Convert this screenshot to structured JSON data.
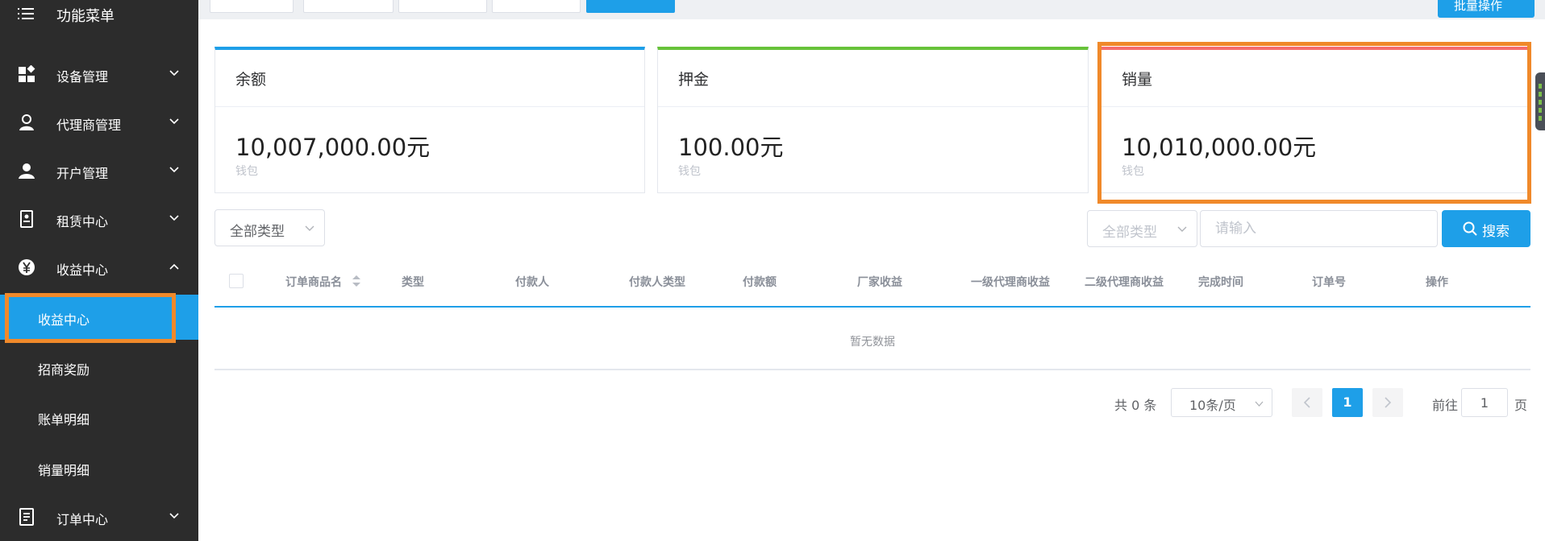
{
  "sidebar": {
    "menu_title": "功能菜单",
    "items": [
      {
        "label": "设备管理"
      },
      {
        "label": "代理商管理"
      },
      {
        "label": "开户管理"
      },
      {
        "label": "租赁中心"
      },
      {
        "label": "收益中心"
      }
    ],
    "sub_items": [
      {
        "label": "收益中心"
      },
      {
        "label": "招商奖励"
      },
      {
        "label": "账单明细"
      },
      {
        "label": "销量明细"
      }
    ],
    "bottom_item": {
      "label": "订单中心"
    }
  },
  "topbar": {
    "batch_button": "批量操作"
  },
  "cards": [
    {
      "title": "余额",
      "value": "10,007,000.00元",
      "sub": "钱包",
      "accent": "#1e9fe8"
    },
    {
      "title": "押金",
      "value": "100.00元",
      "sub": "钱包",
      "accent": "#67c23a"
    },
    {
      "title": "销量",
      "value": "10,010,000.00元",
      "sub": "钱包",
      "accent": "#f56c6c"
    }
  ],
  "filters": {
    "type_select": "全部类型",
    "type_select_right": "全部类型",
    "search_placeholder": "请输入",
    "search_button": "搜索"
  },
  "table": {
    "columns": [
      "订单商品名",
      "类型",
      "付款人",
      "付款人类型",
      "付款额",
      "厂家收益",
      "一级代理商收益",
      "二级代理商收益",
      "完成时间",
      "订单号",
      "操作"
    ],
    "empty_text": "暂无数据"
  },
  "pagination": {
    "total": "共 0 条",
    "page_size": "10条/页",
    "current_page": "1",
    "goto_label": "前往",
    "goto_value": "1",
    "page_suffix": "页"
  },
  "colors": {
    "primary": "#1e9fe8",
    "sidebar_bg": "#2c2c2c",
    "highlight": "#f0892a"
  }
}
